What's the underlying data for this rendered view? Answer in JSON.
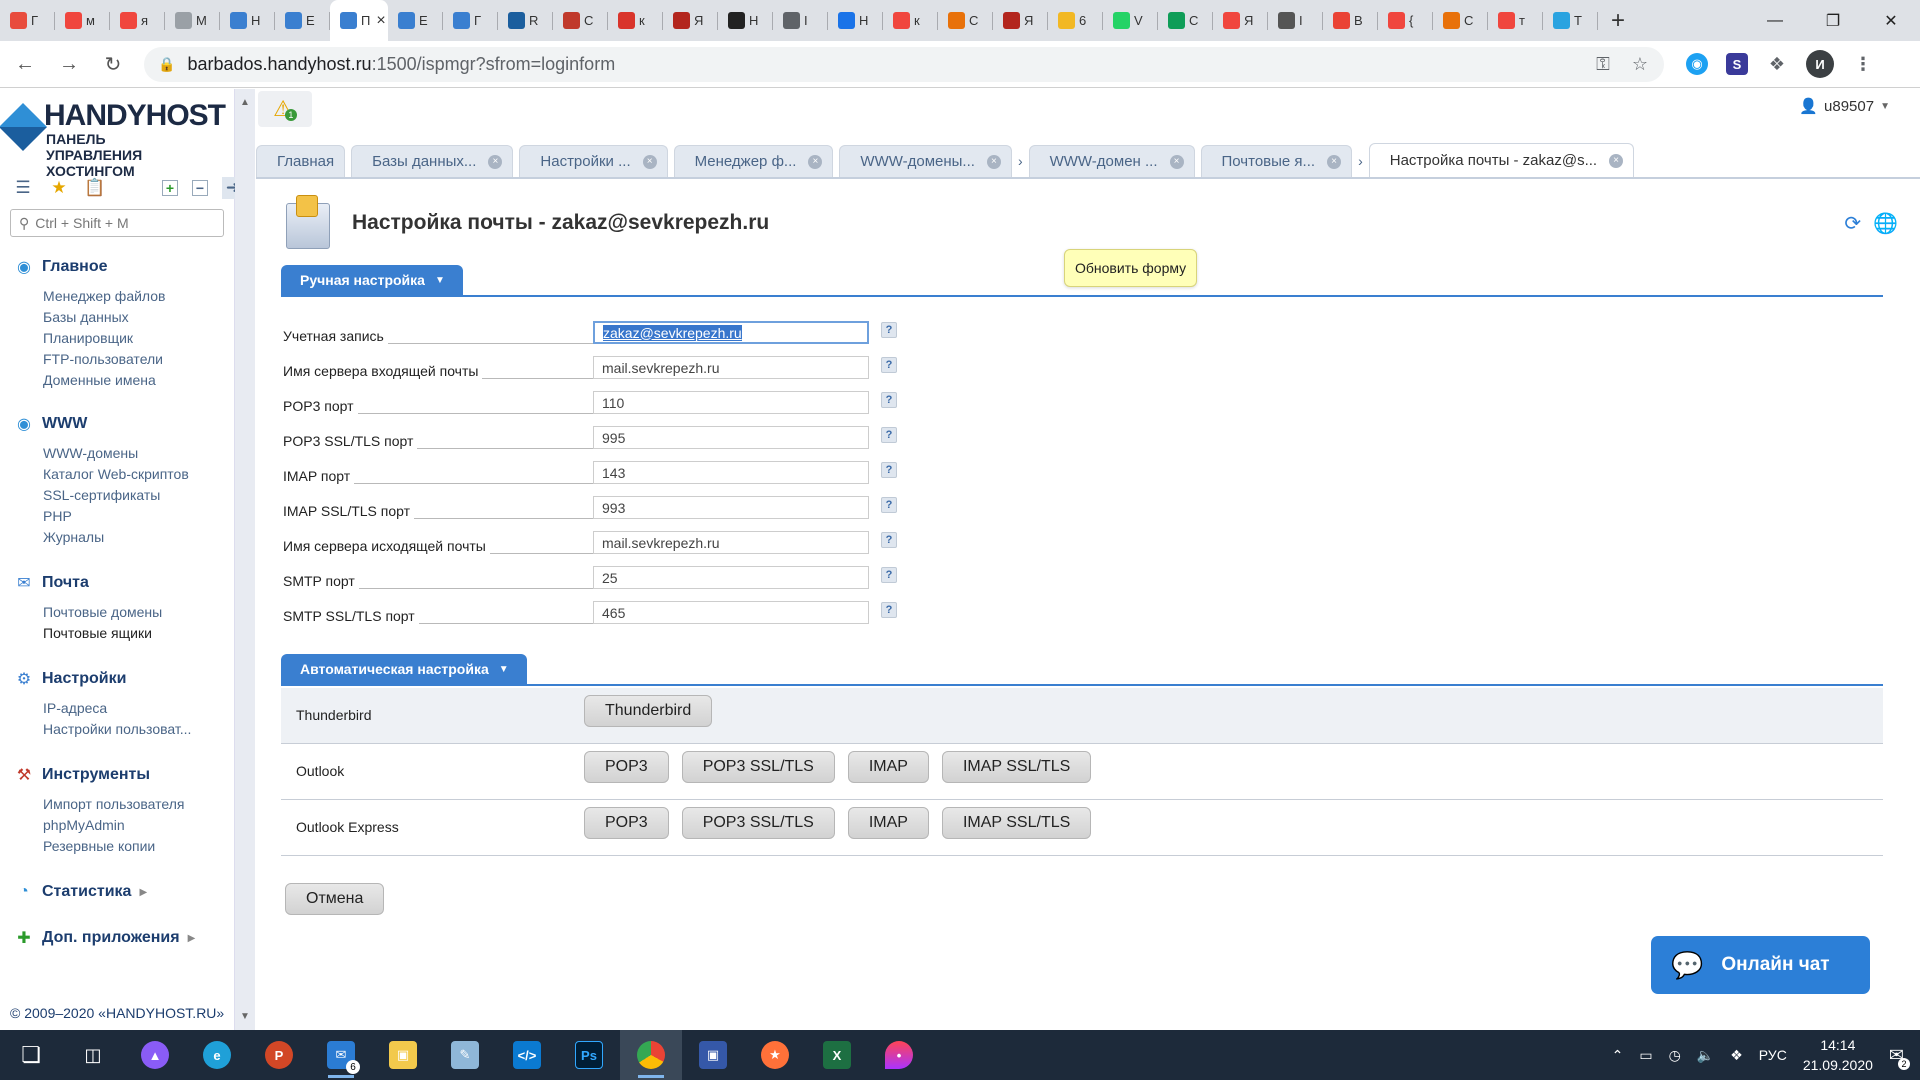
{
  "browser": {
    "tabs": [
      {
        "label": "Г",
        "color": "#e84c3d"
      },
      {
        "label": "м",
        "color": "#f0463e"
      },
      {
        "label": "я",
        "color": "#f0463e"
      },
      {
        "label": "M",
        "color": "#9aa0a6"
      },
      {
        "label": "Н",
        "color": "#3a7fd0"
      },
      {
        "label": "Е",
        "color": "#3a7fd0"
      },
      {
        "label": "П",
        "color": "#3a7fd0",
        "active": true
      },
      {
        "label": "Е",
        "color": "#3a7fd0"
      },
      {
        "label": "Г",
        "color": "#3a7fd0"
      },
      {
        "label": "R",
        "color": "#1b5e9e"
      },
      {
        "label": "С",
        "color": "#c0392b"
      },
      {
        "label": "к",
        "color": "#d9342b"
      },
      {
        "label": "Я",
        "color": "#b3261e"
      },
      {
        "label": "Н",
        "color": "#222222"
      },
      {
        "label": "I",
        "color": "#5f6368"
      },
      {
        "label": "Н",
        "color": "#1a73e8"
      },
      {
        "label": "к",
        "color": "#f0463e"
      },
      {
        "label": "С",
        "color": "#e8710a"
      },
      {
        "label": "Я",
        "color": "#b3261e"
      },
      {
        "label": "6",
        "color": "#f2b824"
      },
      {
        "label": "V",
        "color": "#25d366"
      },
      {
        "label": "С",
        "color": "#0f9d58"
      },
      {
        "label": "Я",
        "color": "#f0463e"
      },
      {
        "label": "I",
        "color": "#555555"
      },
      {
        "label": "В",
        "color": "#ea4335"
      },
      {
        "label": "{",
        "color": "#f0463e"
      },
      {
        "label": "С",
        "color": "#e8710a"
      },
      {
        "label": "т",
        "color": "#f0463e"
      },
      {
        "label": "Т",
        "color": "#2aa3e0"
      }
    ],
    "url_host": "barbados.handyhost.ru",
    "url_path": ":1500/ispmgr?sfrom=loginform",
    "profile_initial": "И"
  },
  "app": {
    "logo_brand": "HANDYHOST",
    "logo_sub": "ПАНЕЛЬ УПРАВЛЕНИЯ ХОСТИНГОМ",
    "search_placeholder": "Ctrl + Shift + M",
    "alert_count": "1",
    "user": "u89507",
    "footer": "© 2009–2020 «HANDYHOST.RU»",
    "sidebar": [
      {
        "title": "Главное",
        "icon": "home-globe-icon",
        "items": [
          "Менеджер файлов",
          "Базы данных",
          "Планировщик",
          "FTP-пользователи",
          "Доменные имена"
        ]
      },
      {
        "title": "WWW",
        "icon": "www-globe-icon",
        "items": [
          "WWW-домены",
          "Каталог Web-скриптов",
          "SSL-сертификаты",
          "PHP",
          "Журналы"
        ]
      },
      {
        "title": "Почта",
        "icon": "mail-icon",
        "items": [
          "Почтовые домены",
          "Почтовые ящики"
        ]
      },
      {
        "title": "Настройки",
        "icon": "settings-icon",
        "items": [
          "IP-адреса",
          "Настройки пользоват..."
        ]
      },
      {
        "title": "Инструменты",
        "icon": "tools-icon",
        "items": [
          "Импорт пользователя",
          "phpMyAdmin",
          "Резервные копии"
        ]
      },
      {
        "title": "Статистика",
        "icon": "stats-icon",
        "items": []
      },
      {
        "title": "Доп. приложения",
        "icon": "plus-icon",
        "items": []
      }
    ],
    "tabs": [
      "Главная",
      "Базы данных...",
      "Настройки ...",
      "Менеджер ф...",
      "WWW-домены...",
      "WWW-домен ...",
      "Почтовые я...",
      "Настройка почты - zakaz@s..."
    ],
    "page_title": "Настройка почты - zakaz@sevkrepezh.ru",
    "tooltip": "Обновить форму",
    "manual_section": "Ручная настройка",
    "auto_section": "Автоматическая настройка",
    "fields": [
      {
        "label": "Учетная запись",
        "value": "zakaz@sevkrepezh.ru"
      },
      {
        "label": "Имя сервера входящей почты",
        "value": "mail.sevkrepezh.ru"
      },
      {
        "label": "POP3 порт",
        "value": "110"
      },
      {
        "label": "POP3 SSL/TLS порт",
        "value": "995"
      },
      {
        "label": "IMAP порт",
        "value": "143"
      },
      {
        "label": "IMAP SSL/TLS порт",
        "value": "993"
      },
      {
        "label": "Имя сервера исходящей почты",
        "value": "mail.sevkrepezh.ru"
      },
      {
        "label": "SMTP порт",
        "value": "25"
      },
      {
        "label": "SMTP SSL/TLS порт",
        "value": "465"
      }
    ],
    "help_mark": "?",
    "auto_rows": [
      {
        "label": "Thunderbird",
        "buttons": [
          "Thunderbird"
        ]
      },
      {
        "label": "Outlook",
        "buttons": [
          "POP3",
          "POP3 SSL/TLS",
          "IMAP",
          "IMAP SSL/TLS"
        ]
      },
      {
        "label": "Outlook Express",
        "buttons": [
          "POP3",
          "POP3 SSL/TLS",
          "IMAP",
          "IMAP SSL/TLS"
        ]
      }
    ],
    "cancel": "Отмена",
    "chat": "Онлайн чат"
  },
  "taskbar": {
    "lang": "РУС",
    "time": "14:14",
    "date": "21.09.2020",
    "mail_badge": "6",
    "notify_badge": "2"
  },
  "colors": {
    "accent": "#3a7fd0",
    "chat": "#2c7fd7",
    "taskbar": "#1d2a3a"
  }
}
